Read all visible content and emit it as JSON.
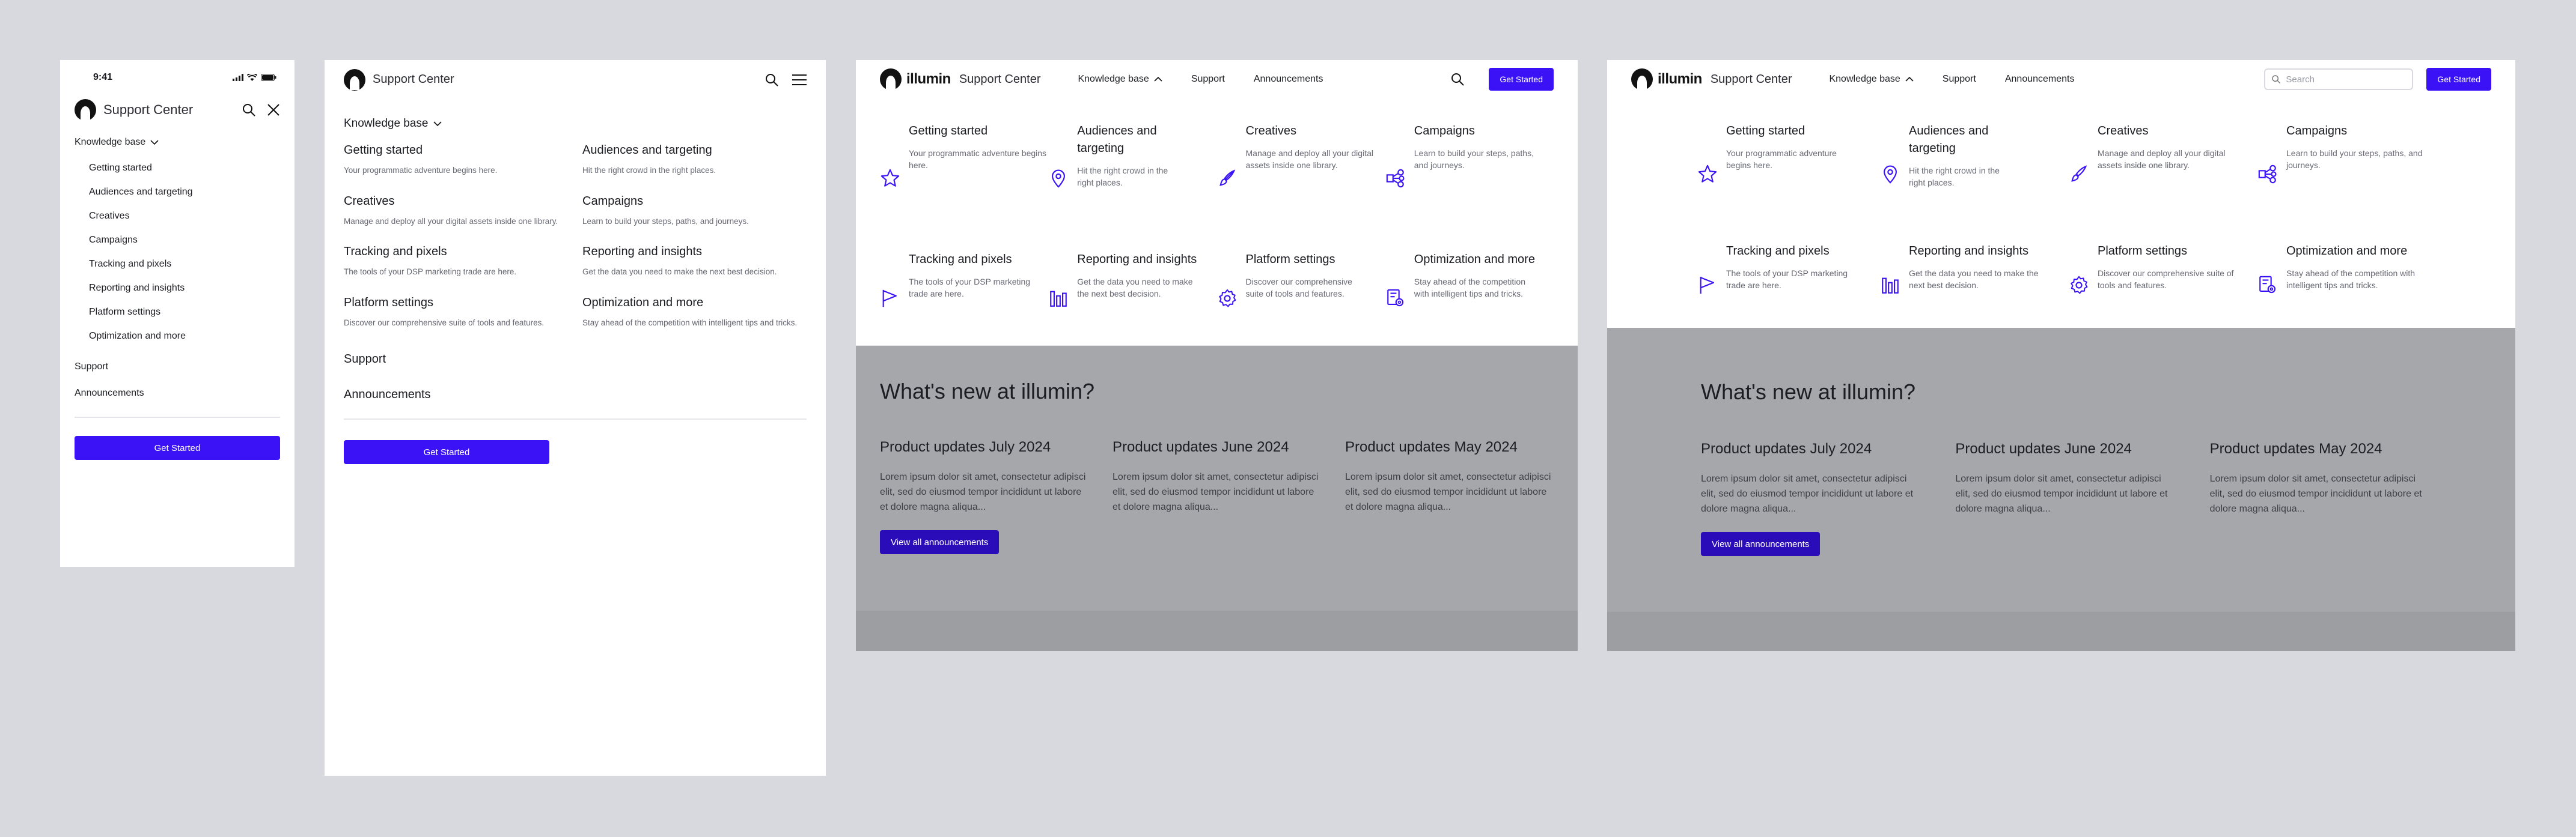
{
  "brand": {
    "name": "illumin",
    "support_center": "Support Center",
    "accent": "#3b12f5",
    "logo_icon": "illumin-logo-icon"
  },
  "status_bar": {
    "time": "9:41",
    "icons": [
      "cellular-signal-icon",
      "wifi-icon",
      "battery-icon"
    ]
  },
  "nav": {
    "knowledge_base": "Knowledge base",
    "support": "Support",
    "announcements": "Announcements",
    "get_started": "Get Started",
    "search_placeholder": "Search"
  },
  "kb_items": [
    {
      "title": "Getting started",
      "desc": "Your programmatic adventure begins here.",
      "icon": "star-icon"
    },
    {
      "title": "Audiences and targeting",
      "desc": "Hit the right crowd in the right places.",
      "icon": "location-pin-icon"
    },
    {
      "title": "Creatives",
      "desc": "Manage and deploy all your digital assets inside one library.",
      "icon": "brush-icon"
    },
    {
      "title": "Campaigns",
      "desc": "Learn to build your steps, paths, and journeys.",
      "icon": "share-nodes-icon"
    },
    {
      "title": "Tracking and pixels",
      "desc": "The tools of your DSP marketing trade are here.",
      "icon": "flag-icon"
    },
    {
      "title": "Reporting and insights",
      "desc": "Get the data you need to make the next best decision.",
      "icon": "bar-chart-icon"
    },
    {
      "title": "Platform settings",
      "desc": "Discover our comprehensive suite of tools and features.",
      "icon": "gear-icon"
    },
    {
      "title": "Optimization and more",
      "desc": "Stay ahead of the competition with intelligent tips and tricks.",
      "icon": "optimize-icon"
    }
  ],
  "whats_new": {
    "title": "What's new at illumin?",
    "cards": [
      {
        "title": "Product updates July 2024",
        "body": "Lorem ipsum dolor sit amet, consectetur adipisci elit, sed do eiusmod tempor incididunt ut labore et dolore magna aliqua..."
      },
      {
        "title": "Product updates June 2024",
        "body": "Lorem ipsum dolor sit amet, consectetur adipisci elit, sed do eiusmod tempor incididunt ut labore et dolore magna aliqua..."
      },
      {
        "title": "Product updates May 2024",
        "body": "Lorem ipsum dolor sit amet, consectetur adipisci elit, sed do eiusmod tempor incididunt ut labore et dolore magna aliqua..."
      }
    ],
    "view_all": "View all announcements"
  }
}
